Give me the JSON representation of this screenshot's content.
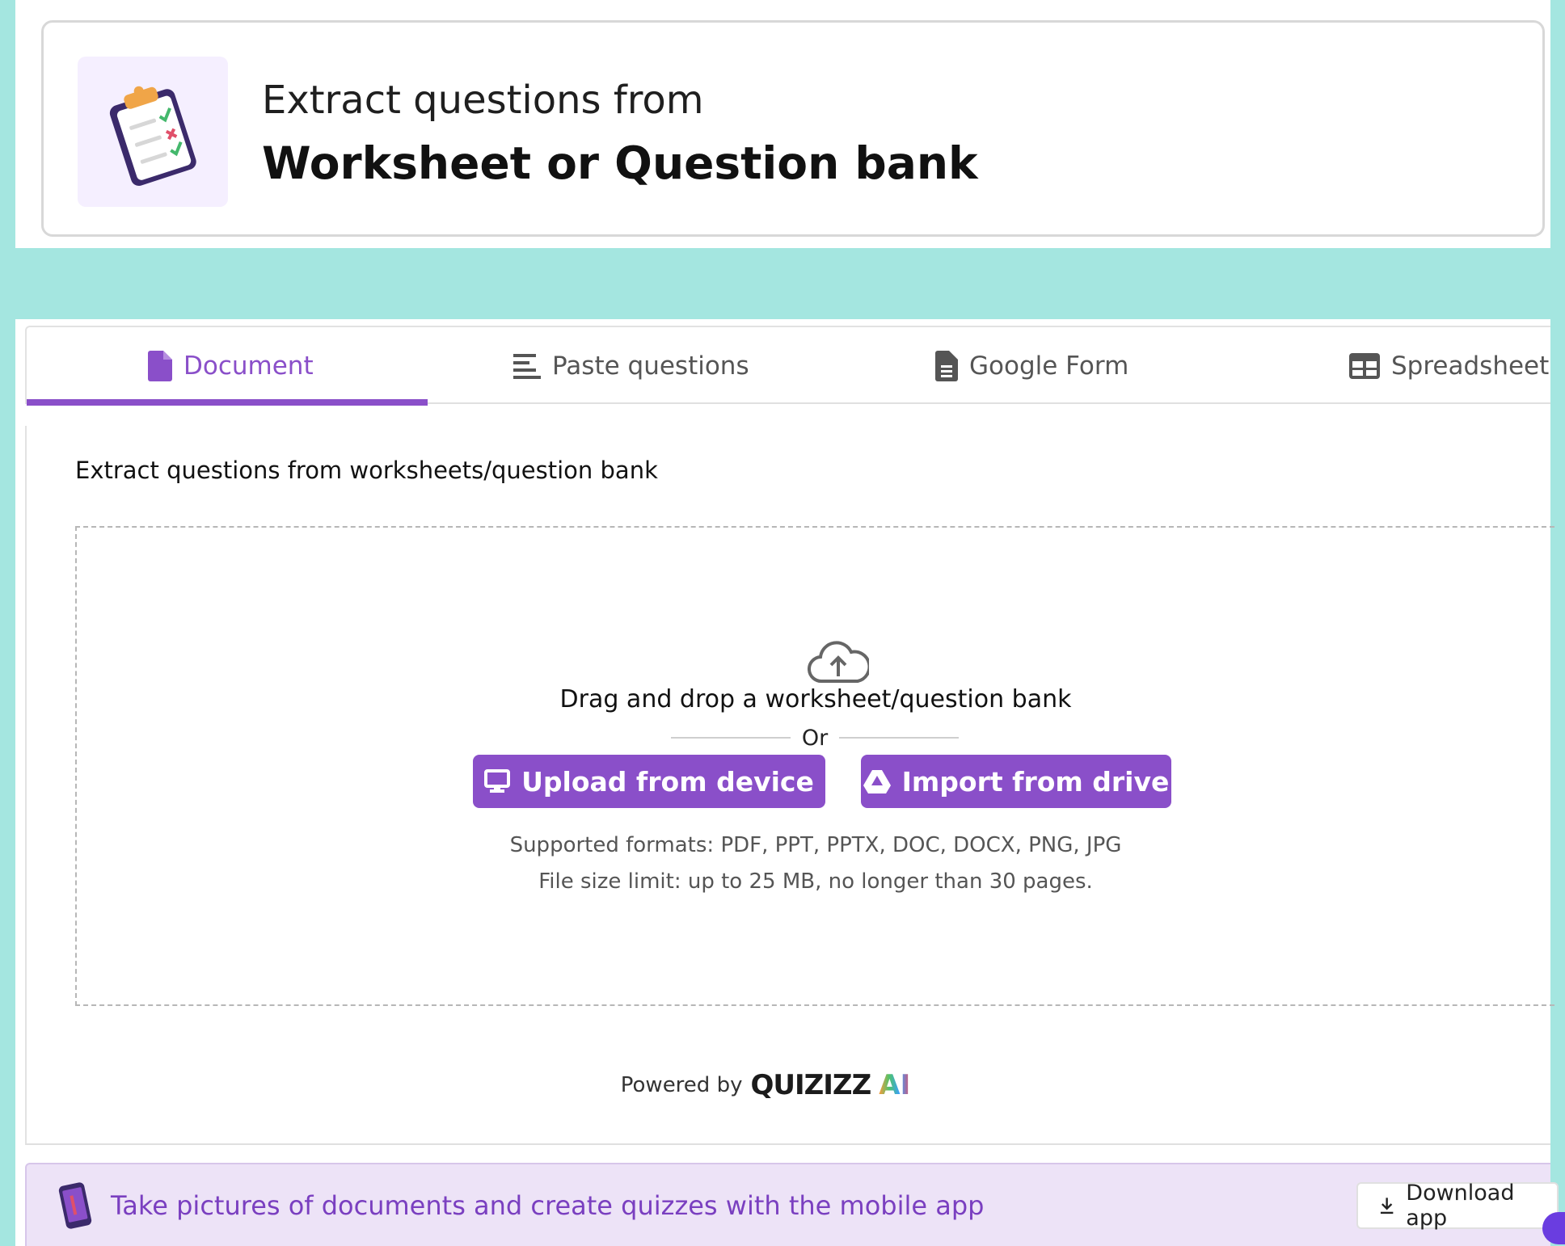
{
  "header": {
    "subtitle": "Extract questions from",
    "title": "Worksheet or Question bank",
    "illustration": "clipboard-checklist-illustration"
  },
  "tabs": [
    {
      "label": "Document",
      "icon": "document-icon",
      "active": true
    },
    {
      "label": "Paste questions",
      "icon": "text-lines-icon",
      "active": false
    },
    {
      "label": "Google Form",
      "icon": "form-document-icon",
      "active": false
    },
    {
      "label": "Spreadsheet",
      "icon": "table-icon",
      "active": false
    }
  ],
  "content": {
    "section_label": "Extract questions from worksheets/question bank",
    "dropzone": {
      "icon": "cloud-upload-icon",
      "text": "Drag and drop a worksheet/question bank",
      "or_text": "Or",
      "upload_button": "Upload from device",
      "drive_button": "Import from drive",
      "formats": "Supported formats: PDF, PPT, PPTX, DOC, DOCX, PNG, JPG",
      "limit": "File size limit: up to 25 MB, no longer than 30 pages."
    },
    "powered_by": {
      "label": "Powered by",
      "brand": "QUIZIZZ",
      "brand_suffix": "AI"
    }
  },
  "banner": {
    "text": "Take pictures of documents and create quizzes with the mobile app",
    "download_label": "Download app"
  },
  "colors": {
    "accent": "#8a4fc9",
    "page_background": "#a4e6e0",
    "banner_background": "#ede3f7"
  }
}
